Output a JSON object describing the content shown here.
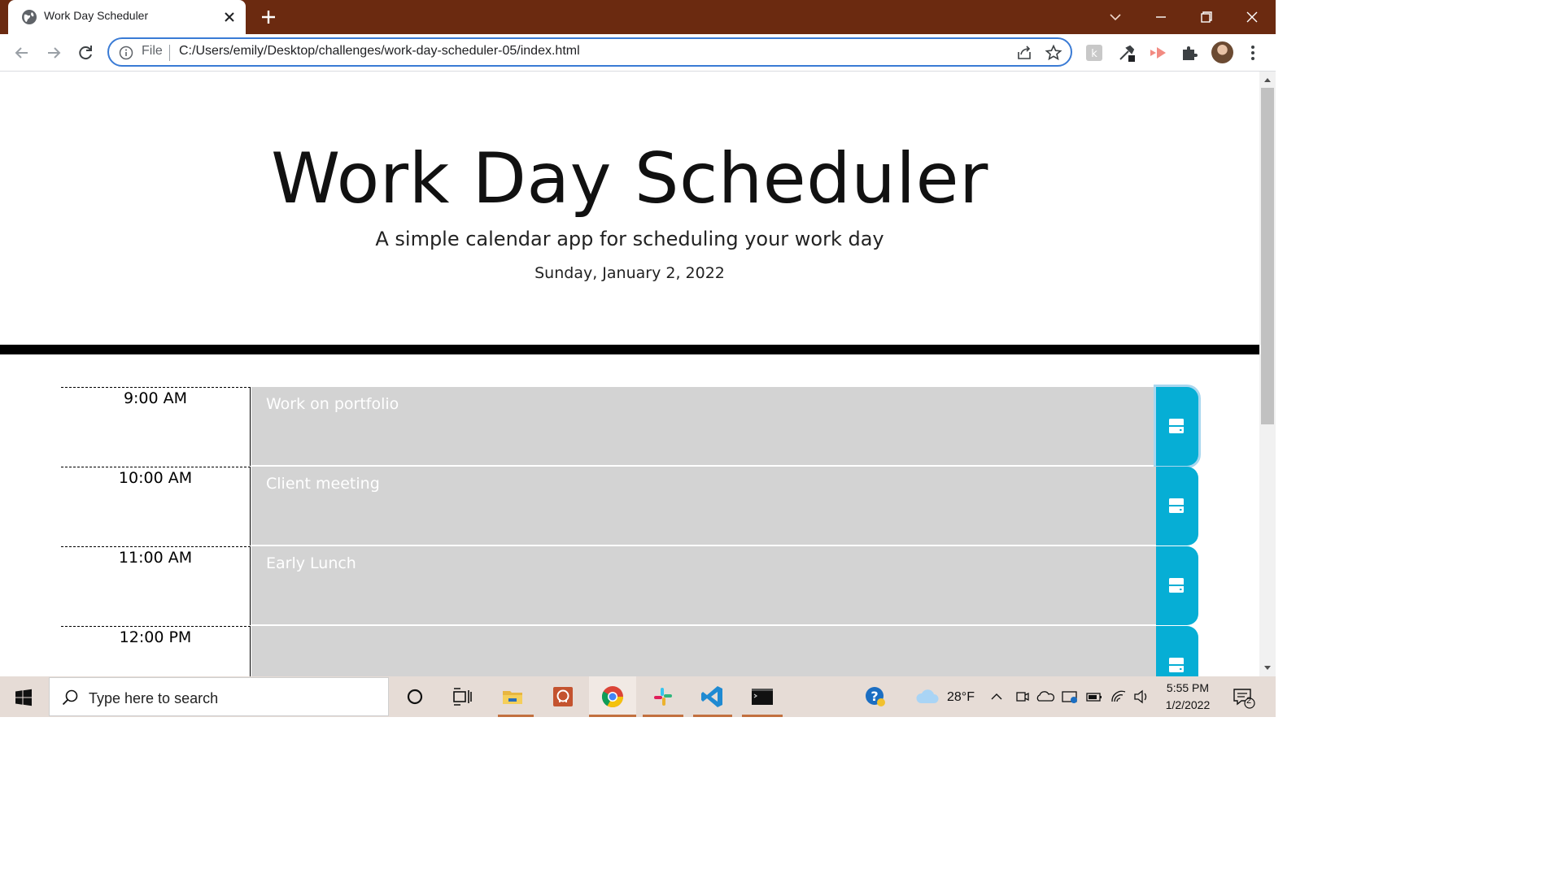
{
  "browser": {
    "tab_title": "Work Day Scheduler",
    "omnibox_scheme": "File",
    "url": "C:/Users/emily/Desktop/challenges/work-day-scheduler-05/index.html"
  },
  "page": {
    "title": "Work Day Scheduler",
    "lead": "A simple calendar app for scheduling your work day",
    "current_date": "Sunday, January 2, 2022"
  },
  "timeblocks": [
    {
      "hour": "9:00 AM",
      "text": "Work on portfolio"
    },
    {
      "hour": "10:00 AM",
      "text": "Client meeting"
    },
    {
      "hour": "11:00 AM",
      "text": "Early Lunch"
    },
    {
      "hour": "12:00 PM",
      "text": ""
    }
  ],
  "colors": {
    "past_block": "#d3d3d3",
    "save_button": "#06aed5",
    "tabstrip": "#6b2a10",
    "taskbar": "#e6dcd6"
  },
  "taskbar": {
    "search_placeholder": "Type here to search",
    "weather_temp": "28°F",
    "time": "5:55 PM",
    "date": "1/2/2022",
    "notification_count": "2"
  },
  "icons": {
    "save": "save-floppy-icon",
    "taskbar_apps": [
      "cortana-icon",
      "task-view-icon",
      "file-explorer-icon",
      "app-icon",
      "chrome-icon",
      "slack-icon",
      "vscode-icon",
      "terminal-icon"
    ]
  }
}
